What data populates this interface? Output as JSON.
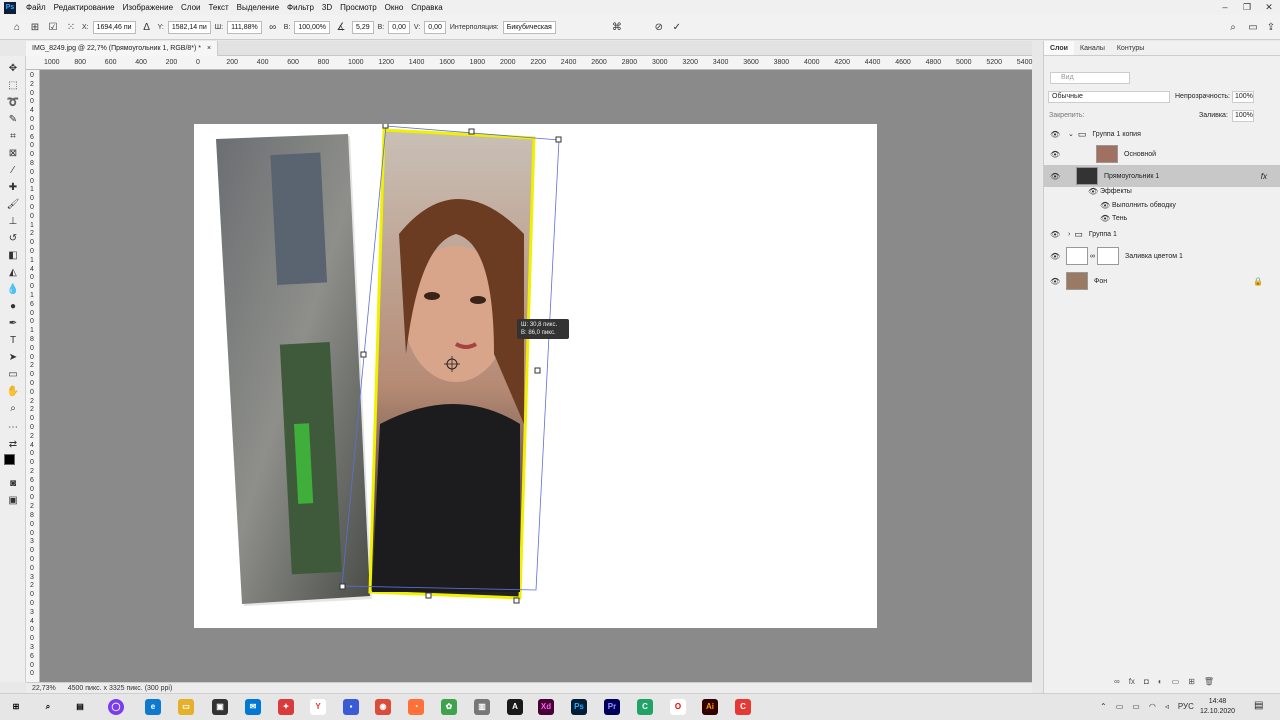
{
  "app": {
    "logo": "Ps"
  },
  "menu": [
    "Файл",
    "Редактирование",
    "Изображение",
    "Слои",
    "Текст",
    "Выделение",
    "Фильтр",
    "3D",
    "Просмотр",
    "Окно",
    "Справка"
  ],
  "options": {
    "x_label": "X:",
    "x_value": "1694,46 пи",
    "y_label": "Y:",
    "y_value": "1582,14 пи",
    "w_label": "Ш:",
    "w_value": "111,88%",
    "h_label": "В:",
    "h_value": "100,00%",
    "angle_value": "5,29",
    "skew_h_label": "В:",
    "skew_h_value": "0,00",
    "skew_v_label": "V:",
    "skew_v_value": "0,00",
    "interp_label": "Интерполяция:",
    "interp_value": "Бикубическая"
  },
  "document": {
    "tab_title": "IMG_8249.jpg @ 22,7% (Прямоугольник 1, RGB/8*) *",
    "close": "×"
  },
  "rulers": {
    "h_ticks": [
      "1000",
      "800",
      "600",
      "400",
      "200",
      "0",
      "200",
      "400",
      "600",
      "800",
      "1000",
      "1200",
      "1400",
      "1600",
      "1800",
      "2000",
      "2200",
      "2400",
      "2600",
      "2800",
      "3000",
      "3200",
      "3400",
      "3600",
      "3800",
      "4000",
      "4200",
      "4400",
      "4600",
      "4800",
      "5000",
      "5200",
      "5400"
    ],
    "v_ticks": [
      "0",
      "2",
      "0",
      "0",
      "4",
      "0",
      "0",
      "6",
      "0",
      "0",
      "8",
      "0",
      "0",
      "1",
      "0",
      "0",
      "0",
      "1",
      "2",
      "0",
      "0",
      "1",
      "4",
      "0",
      "0",
      "1",
      "6",
      "0",
      "0",
      "1",
      "8",
      "0",
      "0",
      "2",
      "0",
      "0",
      "0",
      "2",
      "2",
      "0",
      "0",
      "2",
      "4",
      "0",
      "0",
      "2",
      "6",
      "0",
      "0",
      "2",
      "8",
      "0",
      "0",
      "3",
      "0",
      "0",
      "0",
      "3",
      "2",
      "0",
      "0",
      "3",
      "4",
      "0",
      "0",
      "3",
      "6",
      "0",
      "0"
    ]
  },
  "transform_tooltip": {
    "line1": "Ш: 30,8 пикс.",
    "line2": "В: 86,0 пикс."
  },
  "status": {
    "zoom": "22,73%",
    "doc_info": "4500 пикс. x 3325 пикс. (300 ppi)"
  },
  "panel": {
    "tabs": [
      "Слои",
      "Каналы",
      "Контуры"
    ],
    "search_placeholder": "Вид",
    "blend_mode": "Обычные",
    "opacity_label": "Непрозрачность:",
    "opacity_value": "100%",
    "lock_label": "Закрепить:",
    "fill_label": "Заливка:",
    "fill_value": "100%",
    "layers": [
      {
        "name": "Группа 1 копия"
      },
      {
        "name": "Основной"
      },
      {
        "name": "Прямоугольник 1"
      },
      {
        "name": "Эффекты"
      },
      {
        "name": "Выполнить обводку"
      },
      {
        "name": "Тень"
      },
      {
        "name": "Группа 1"
      },
      {
        "name": "Заливка цветом 1"
      },
      {
        "name": "Фон"
      }
    ]
  },
  "taskbar": {
    "lang": "РУС",
    "time": "14:48",
    "date": "12.10.2020"
  },
  "colors": {
    "accent": "#1473e6",
    "selection": "#f0f000",
    "canvas_bg": "#8a8a8a"
  }
}
